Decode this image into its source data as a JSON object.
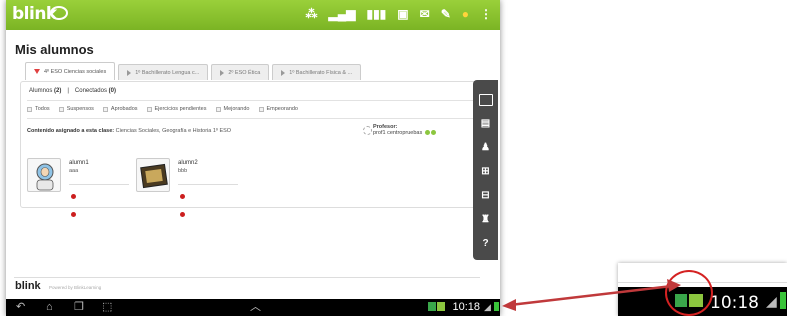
{
  "topbar": {
    "logo": "blink",
    "color": "#8cc63f"
  },
  "page_title": "Mis alumnos",
  "tabs": [
    {
      "label": "4º ESO Ciencias sociales",
      "active": true
    },
    {
      "label": "1º Bachillerato Lengua c...",
      "active": false
    },
    {
      "label": "2º ESO Ética",
      "active": false
    },
    {
      "label": "1º Bachillerato Física & ...",
      "active": false
    }
  ],
  "counts": {
    "alumnos_label": "Alumnos",
    "alumnos_value": "(2)",
    "sep": "|",
    "conectados_label": "Conectados",
    "conectados_value": "(0)"
  },
  "filters": [
    "Todos",
    "Suspensos",
    "Aprobados",
    "Ejercicios pendientes",
    "Mejorando",
    "Empeorando"
  ],
  "content": {
    "label": "Contenido asignado a esta clase:",
    "value": "Ciencias Sociales, Geografía e Historia 1º ESO"
  },
  "professor": {
    "label": "Profesor:",
    "name": "prof1 centropruebas"
  },
  "students": [
    {
      "name": "alumn1",
      "sub": "aaa"
    },
    {
      "name": "alumn2",
      "sub": "bbb"
    }
  ],
  "sidetools": [
    "mail-icon",
    "edit-doc-icon",
    "user-edit-icon",
    "grid-add-icon",
    "grid-remove-icon",
    "users-icon",
    "help-icon"
  ],
  "help_label": "?",
  "footer": {
    "logo": "blink",
    "note": "Powered by BlinkLearning"
  },
  "navbar": {
    "time": "10:18"
  },
  "zoom": {
    "time": "10:18"
  },
  "colors": {
    "accent": "#8cc63f",
    "arrow": "#c0393b",
    "circle": "#d42222"
  }
}
